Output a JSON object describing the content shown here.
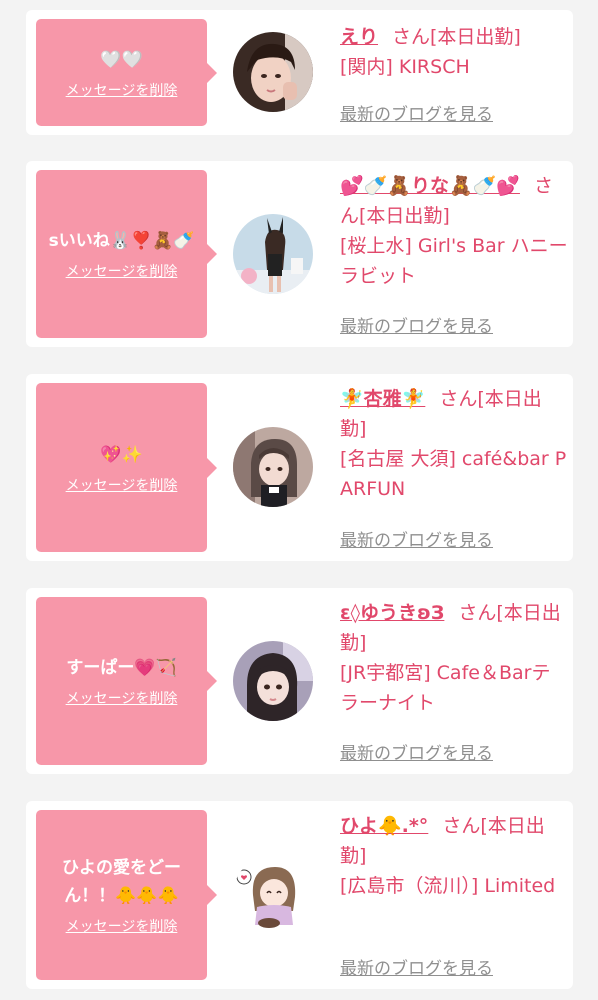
{
  "accent_color": "#e1486b",
  "bubble_color": "#f797a9",
  "items": [
    {
      "message": "🤍🤍",
      "delete_label": "メッセージを削除",
      "name": "えり",
      "honorific": "さん[本日出勤]",
      "shop": "[関内] KIRSCH",
      "blog_link": "最新のブログを見る"
    },
    {
      "message": "sいいね🐰❣️🧸🍼",
      "delete_label": "メッセージを削除",
      "name": "💕🍼🧸りな🧸🍼💕",
      "honorific": "さん[本日出勤]",
      "shop": "[桜上水] Girl's Bar ハニーラビット",
      "blog_link": "最新のブログを見る"
    },
    {
      "message": "💖✨",
      "delete_label": "メッセージを削除",
      "name": "🧚杏雅🧚",
      "honorific": "さん[本日出勤]",
      "shop": "[名古屋 大須] café&bar PARFUN",
      "blog_link": "最新のブログを見る"
    },
    {
      "message": "すーぱー💗🏹",
      "delete_label": "メッセージを削除",
      "name": "ɛ◊ゆうきʚЗ",
      "honorific": "さん[本日出勤]",
      "shop": "[JR宇都宮] Cafe＆Barテラーナイト",
      "blog_link": "最新のブログを見る"
    },
    {
      "message": "ひよの愛をどーん！！🐥🐥🐥",
      "delete_label": "メッセージを削除",
      "name": "ひよ🐥.*°",
      "honorific": "さん[本日出勤]",
      "shop": "[広島市（流川）] Limited",
      "blog_link": "最新のブログを見る"
    }
  ]
}
